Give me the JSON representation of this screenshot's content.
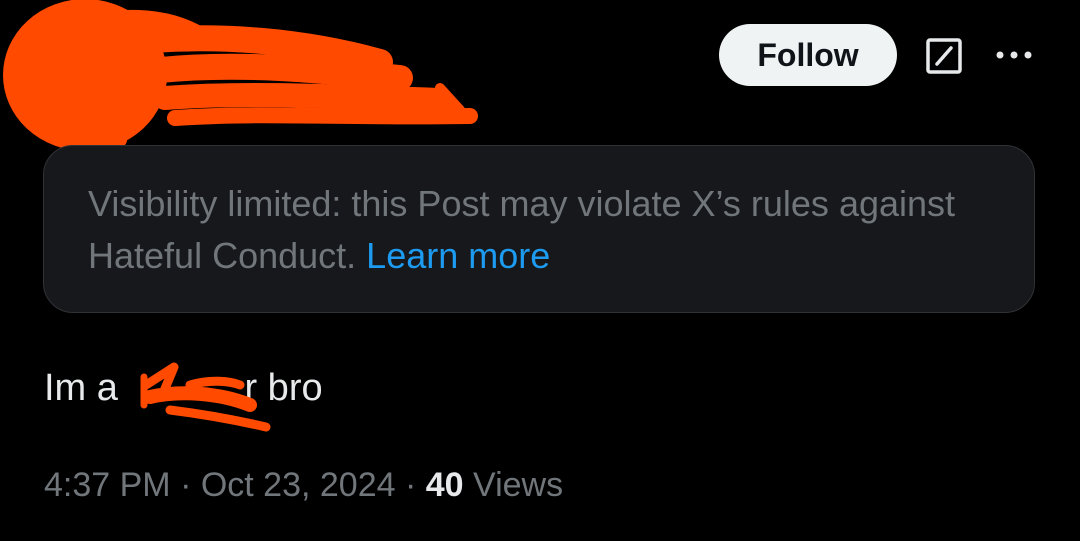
{
  "header": {
    "follow_label": "Follow",
    "grok_icon": "grok-slash-box-icon",
    "more_icon": "more-horizontal-icon",
    "redaction_color": "#ff4a00"
  },
  "notice": {
    "text": "Visibility limited: this Post may violate X’s rules against Hateful Conduct.",
    "link_label": "Learn more",
    "link_color": "#1d9bf0"
  },
  "post": {
    "text_before": "Im a ",
    "text_visible_fragment": "r bro"
  },
  "meta": {
    "time": "4:37 PM",
    "separator_1": " · ",
    "date": "Oct 23, 2024",
    "separator_2": " · ",
    "views_count": "40",
    "views_label": " Views"
  },
  "colors": {
    "background": "#000000",
    "primary_text": "#e7e9ea",
    "secondary_text": "#71767b",
    "notice_bg": "#16181c",
    "accent": "#1d9bf0"
  }
}
